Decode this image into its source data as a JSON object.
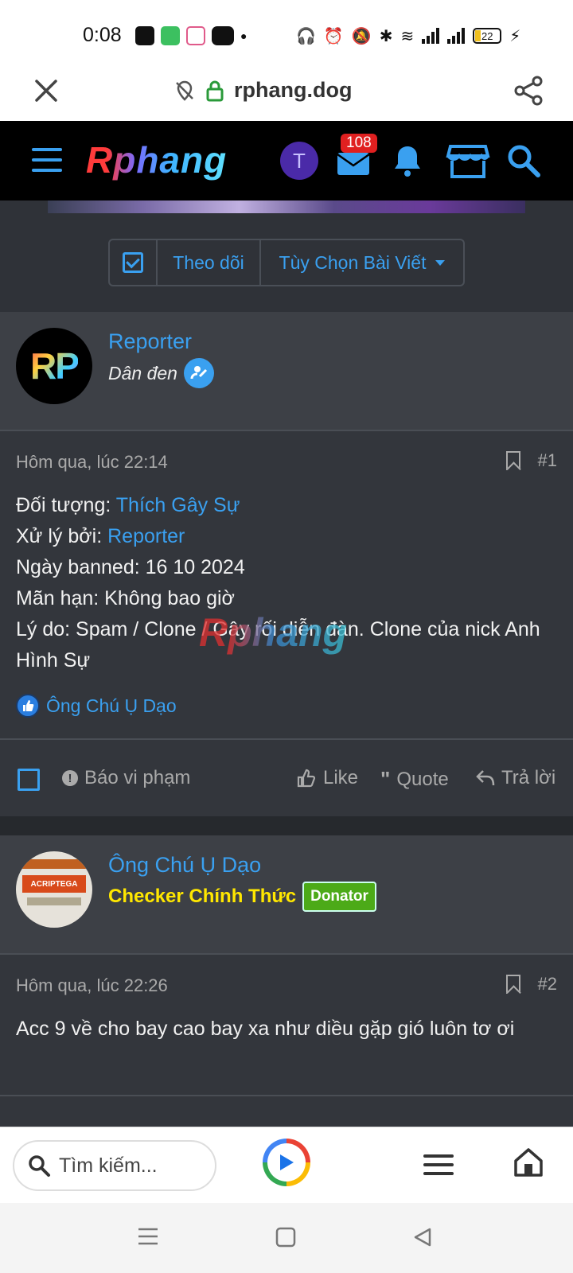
{
  "status_bar": {
    "time": "0:08",
    "battery": "22"
  },
  "url_bar": {
    "domain": "rphang.dog"
  },
  "site_nav": {
    "logo_text": "Rphang",
    "avatar_letter": "T",
    "messages_badge": "108"
  },
  "thread_controls": {
    "follow_label": "Theo dõi",
    "options_label": "Tùy Chọn Bài Viết"
  },
  "posts": [
    {
      "author": "Reporter",
      "user_title": "Dân đen",
      "avatar_text": "RP",
      "date": "Hôm qua, lúc 22:14",
      "number": "#1",
      "lines": {
        "subject_label": "Đối tượng: ",
        "subject_value": "Thích Gây Sự",
        "handled_label": "Xử lý bởi: ",
        "handled_value": "Reporter",
        "banned": "Ngày banned: 16 10 2024",
        "expiry": "Mãn hạn: Không bao giờ",
        "reason": "Lý do: Spam / Clone / Gây rối diễn đàn. Clone của nick Anh Hình Sự"
      },
      "reaction_user": "Ông Chú Ụ Dạo",
      "watermark": "Rphang"
    },
    {
      "author": "Ông Chú Ụ Dạo",
      "user_title": "Checker Chính Thức",
      "banner": "Donator",
      "avatar_label": "ACRIPTEGA",
      "date": "Hôm qua, lúc 22:26",
      "number": "#2",
      "text": "Acc 9 về cho bay cao bay xa như diều gặp gió luôn tơ ơi"
    }
  ],
  "post_actions": {
    "report": "Báo vi phạm",
    "like": "Like",
    "quote": "Quote",
    "reply": "Trả lời"
  },
  "bottom_bar": {
    "search_placeholder": "Tìm kiếm..."
  },
  "colors": {
    "accent": "#3aa0f0",
    "page_bg": "#2f3238",
    "post_bg": "#33363c",
    "author_bg": "#3d4046",
    "checker_title": "#ffe700",
    "donator_badge": "#4caa18",
    "messages_badge": "#e02020"
  }
}
